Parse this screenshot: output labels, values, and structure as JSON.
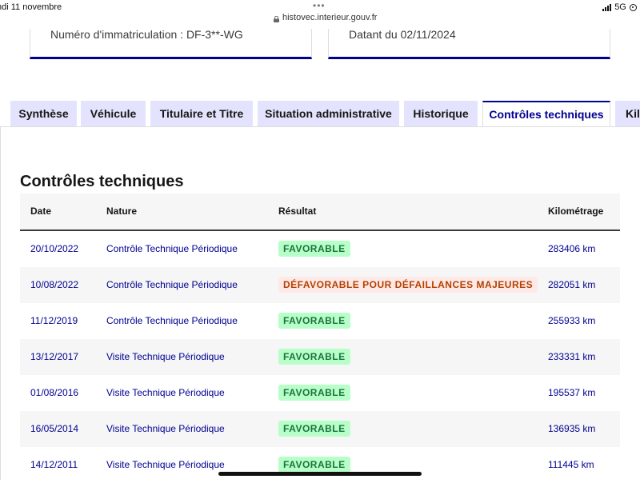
{
  "status_bar": {
    "time": "ndi 11 novembre",
    "dots": "•••",
    "url": "histovec.interieur.gouv.fr",
    "network": "5G",
    "battery_fragment": "5"
  },
  "cards": {
    "registration": "Numéro d'immatriculation : DF-3**-WG",
    "dated": "Datant du 02/11/2024"
  },
  "tabs": [
    {
      "label": "Synthèse",
      "active": false
    },
    {
      "label": "Véhicule",
      "active": false
    },
    {
      "label": "Titulaire et Titre",
      "active": false
    },
    {
      "label": "Situation administrative",
      "active": false
    },
    {
      "label": "Historique",
      "active": false
    },
    {
      "label": "Contrôles techniques",
      "active": true
    },
    {
      "label": "Kil",
      "active": false
    }
  ],
  "section": {
    "title": "Contrôles techniques"
  },
  "table": {
    "headers": [
      "Date",
      "Nature",
      "Résultat",
      "Kilométrage"
    ],
    "rows": [
      {
        "date": "20/10/2022",
        "nature": "Contrôle Technique Périodique",
        "result": "FAVORABLE",
        "status": "ok",
        "km": "283406 km"
      },
      {
        "date": "10/08/2022",
        "nature": "Contrôle Technique Périodique",
        "result": "DÉFAVORABLE POUR DÉFAILLANCES MAJEURES",
        "status": "ko",
        "km": "282051 km"
      },
      {
        "date": "11/12/2019",
        "nature": "Contrôle Technique Périodique",
        "result": "FAVORABLE",
        "status": "ok",
        "km": "255933 km"
      },
      {
        "date": "13/12/2017",
        "nature": "Visite Technique Périodique",
        "result": "FAVORABLE",
        "status": "ok",
        "km": "233331 km"
      },
      {
        "date": "01/08/2016",
        "nature": "Visite Technique Périodique",
        "result": "FAVORABLE",
        "status": "ok",
        "km": "195537 km"
      },
      {
        "date": "16/05/2014",
        "nature": "Visite Technique Périodique",
        "result": "FAVORABLE",
        "status": "ok",
        "km": "136935 km"
      },
      {
        "date": "14/12/2011",
        "nature": "Visite Technique Périodique",
        "result": "FAVORABLE",
        "status": "ok",
        "km": "111445 km"
      }
    ]
  },
  "colors": {
    "primary": "#000091",
    "tab_inactive": "#e3e3fd",
    "success_bg": "#b8fec9",
    "success_text": "#18753c",
    "error_bg": "#ffe9e6",
    "error_text": "#b34000"
  }
}
